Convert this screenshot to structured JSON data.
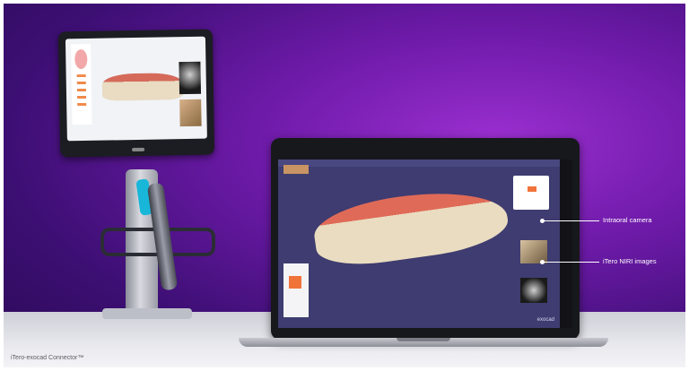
{
  "caption": "iTero-exocad Connector™",
  "callouts": {
    "intraoral_camera": "Intraoral camera",
    "itero_nir_images": "iTero NIRI images"
  },
  "laptop": {
    "brand_text": "exocad"
  },
  "colors": {
    "background_purple": "#6d1aa8",
    "accent_orange": "#f0743a",
    "wand_accent_cyan": "#18b6d8"
  }
}
